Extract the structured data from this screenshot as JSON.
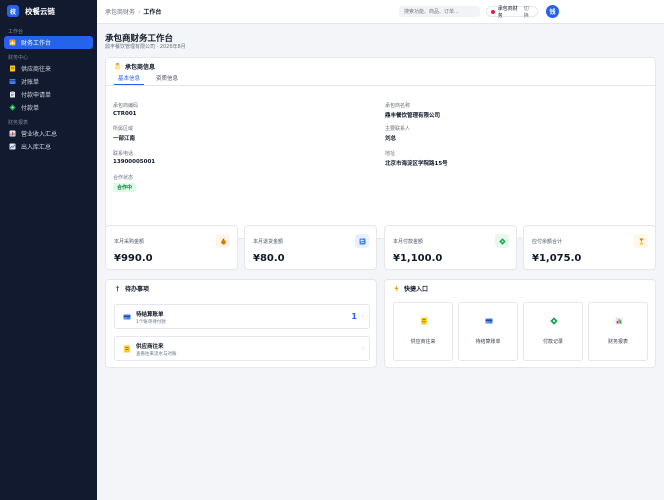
{
  "app": {
    "logo_text": "校",
    "name": "校餐云链"
  },
  "sidebar": {
    "sections": [
      {
        "title": "工作台",
        "items": [
          {
            "label": "财务工作台",
            "icon": "chart-icon",
            "active": true
          }
        ]
      },
      {
        "title": "财务中心",
        "items": [
          {
            "label": "供应商往来",
            "icon": "ledger-icon"
          },
          {
            "label": "对账单",
            "icon": "receipt-icon"
          },
          {
            "label": "付款申请单",
            "icon": "clipboard-icon"
          },
          {
            "label": "付款单",
            "icon": "payment-icon"
          }
        ]
      },
      {
        "title": "财务报表",
        "items": [
          {
            "label": "营业收入汇总",
            "icon": "bar-chart-icon"
          },
          {
            "label": "出入库汇总",
            "icon": "stock-chart-icon"
          }
        ]
      }
    ]
  },
  "topbar": {
    "breadcrumb": [
      "承包商财务",
      "工作台"
    ],
    "search_placeholder": "搜索功能、商品、订单...",
    "switcher_label": "承包商财务",
    "switcher_action": "切换",
    "avatar_text": "钱"
  },
  "page": {
    "title": "承包商财务工作台",
    "subtitle": "鼎丰餐饮管理有限公司 · 2026年8月"
  },
  "contractor_info": {
    "header": "承包商信息",
    "tabs": [
      "基本信息",
      "资质信息"
    ],
    "active_tab": 0,
    "fields": {
      "code": {
        "label": "承包商编码",
        "value": "CTR001"
      },
      "name": {
        "label": "承包商名称",
        "value": "鼎丰餐饮管理有限公司"
      },
      "region": {
        "label": "所属区域",
        "value": "一部江南"
      },
      "contact": {
        "label": "主要联系人",
        "value": "刘总"
      },
      "phone": {
        "label": "联系电话",
        "value": "13900005001"
      },
      "address": {
        "label": "地址",
        "value": "北京市海淀区学院路15号"
      },
      "status": {
        "label": "合作状态",
        "value": "合作中"
      }
    }
  },
  "stats": [
    {
      "label": "本月采购金额",
      "value": "¥990.0",
      "icon": "money-bag-icon",
      "bg": "#fff4e5"
    },
    {
      "label": "本月退货金额",
      "value": "¥80.0",
      "icon": "return-icon",
      "bg": "#e8f0ff"
    },
    {
      "label": "本月付款金额",
      "value": "¥1,100.0",
      "icon": "payment-icon",
      "bg": "#e8f8ee"
    },
    {
      "label": "应付余额合计",
      "value": "¥1,075.0",
      "icon": "hourglass-icon",
      "bg": "#fff8e6"
    }
  ],
  "todo": {
    "header": "待办事项",
    "items": [
      {
        "title": "待结算账单",
        "subtitle": "1个账单待付款",
        "count": "1",
        "icon": "card-icon"
      },
      {
        "title": "供应商往来",
        "subtitle": "查看往来流水与对账",
        "count": "",
        "icon": "ledger-icon"
      }
    ]
  },
  "quick": {
    "header": "快捷入口",
    "items": [
      {
        "label": "供应商往来",
        "icon": "ledger-icon"
      },
      {
        "label": "待结算账单",
        "icon": "card-icon"
      },
      {
        "label": "付款记录",
        "icon": "payment-icon"
      },
      {
        "label": "财务报表",
        "icon": "bar-chart-icon"
      }
    ]
  },
  "colors": {
    "primary": "#2563eb",
    "sidebar_bg": "#111a2e",
    "success": "#15803d"
  }
}
